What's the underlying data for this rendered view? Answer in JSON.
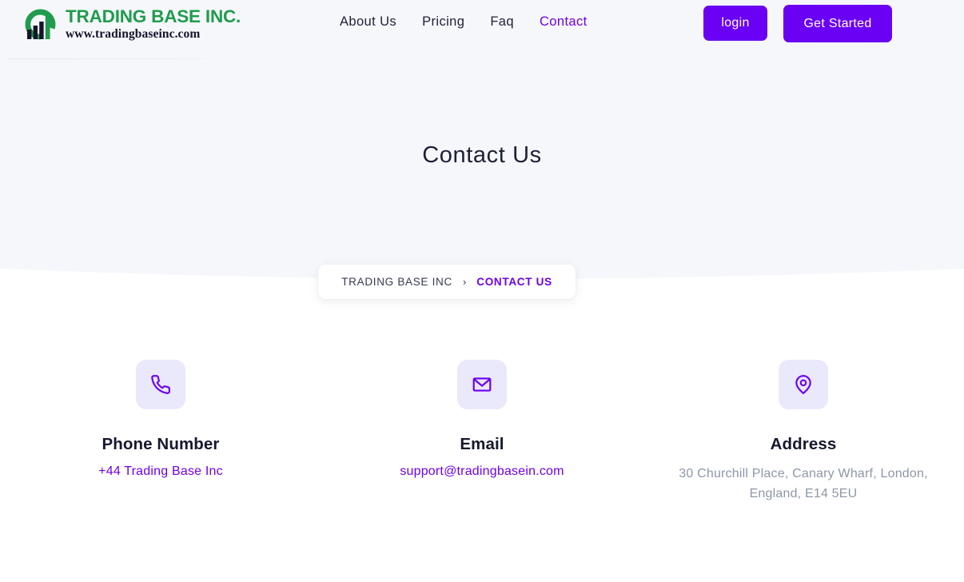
{
  "header": {
    "logo": {
      "title": "TRADING BASE INC.",
      "subtitle": "www.tradingbaseinc.com",
      "mark_icon": "bar-chart-circle-icon",
      "brand_green": "#1f9c4d",
      "brand_dark": "#14142b"
    },
    "nav": [
      {
        "label": "About Us",
        "active": false
      },
      {
        "label": "Pricing",
        "active": false
      },
      {
        "label": "Faq",
        "active": false
      },
      {
        "label": "Contact",
        "active": true
      }
    ],
    "login_label": "login",
    "get_started_label": "Get Started",
    "accent_purple": "#6a00f4"
  },
  "hero": {
    "title": "Contact Us",
    "background": "#f6f7fb"
  },
  "breadcrumb": {
    "root": "TRADING BASE INC",
    "separator": "›",
    "current": "CONTACT US",
    "current_color": "#6f00e8"
  },
  "contacts": [
    {
      "icon": "phone-icon",
      "title": "Phone Number",
      "value": "+44 Trading Base Inc",
      "value_color": "#6f00e8"
    },
    {
      "icon": "mail-icon",
      "title": "Email",
      "value": "support@tradingbasein.com",
      "value_color": "#6f00e8"
    },
    {
      "icon": "location-pin-icon",
      "title": "Address",
      "value": "30 Churchill Place, Canary Wharf, London, England, E14 5EU",
      "value_color": "#8e97a8"
    }
  ]
}
